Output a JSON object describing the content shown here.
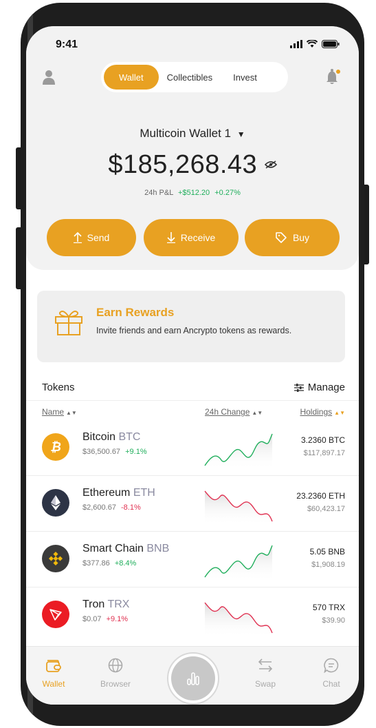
{
  "status": {
    "time": "9:41"
  },
  "top_tabs": [
    {
      "label": "Wallet",
      "active": true
    },
    {
      "label": "Collectibles",
      "active": false
    },
    {
      "label": "Invest",
      "active": false
    }
  ],
  "wallet": {
    "name": "Multicoin Wallet 1",
    "balance": "$185,268.43",
    "pnl_label": "24h P&L",
    "pnl_value": "+$512.20",
    "pnl_percent": "+0.27%"
  },
  "actions": {
    "send": "Send",
    "receive": "Receive",
    "buy": "Buy"
  },
  "rewards": {
    "title": "Earn Rewards",
    "text": "Invite friends and earn Ancrypto tokens as rewards."
  },
  "tokens": {
    "title": "Tokens",
    "manage": "Manage",
    "columns": {
      "name": "Name",
      "change": "24h Change",
      "holdings": "Holdings"
    },
    "rows": [
      {
        "name": "Bitcoin",
        "symbol": "BTC",
        "price": "$36,500.67",
        "change": "+9.1%",
        "holdings": "3.2360 BTC",
        "value": "$117,897.17",
        "icon": "bitcoin-icon"
      },
      {
        "name": "Ethereum",
        "symbol": "ETH",
        "price": "$2,600.67",
        "change": "-8.1%",
        "holdings": "23.2360 ETH",
        "value": "$60,423.17",
        "icon": "ethereum-icon"
      },
      {
        "name": "Smart Chain",
        "symbol": "BNB",
        "price": "$377.86",
        "change": "+8.4%",
        "holdings": "5.05 BNB",
        "value": "$1,908.19",
        "icon": "bnb-icon"
      },
      {
        "name": "Tron",
        "symbol": "TRX",
        "price": "$0.07",
        "change": "+9.1%",
        "holdings": "570 TRX",
        "value": "$39.90",
        "icon": "tron-icon"
      }
    ]
  },
  "nav": {
    "wallet": "Wallet",
    "browser": "Browser",
    "swap": "Swap",
    "chat": "Chat"
  },
  "colors": {
    "accent": "#e8a122",
    "positive": "#1fae5b",
    "negative": "#e03050"
  }
}
